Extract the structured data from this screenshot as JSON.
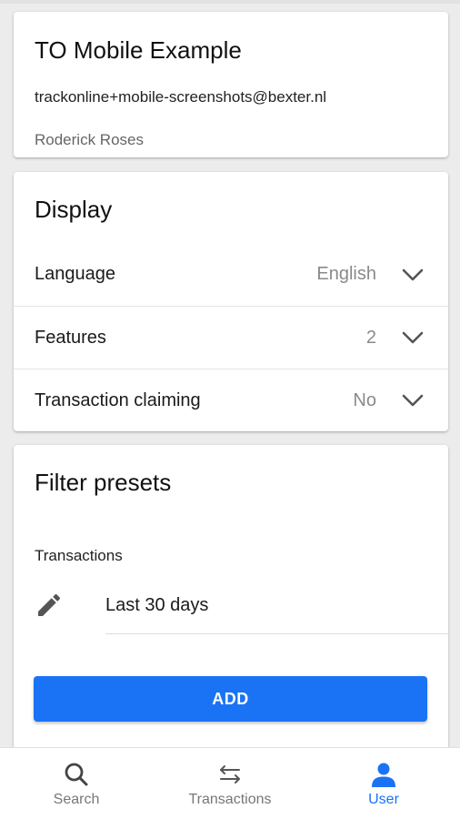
{
  "account": {
    "title": "TO Mobile Example",
    "email": "trackonline+mobile-screenshots@bexter.nl",
    "name": "Roderick Roses"
  },
  "display": {
    "title": "Display",
    "settings": [
      {
        "label": "Language",
        "value": "English"
      },
      {
        "label": "Features",
        "value": "2"
      },
      {
        "label": "Transaction claiming",
        "value": "No"
      }
    ]
  },
  "filter_presets": {
    "title": "Filter presets",
    "subtitle": "Transactions",
    "presets": [
      {
        "label": "Last 30 days",
        "icon": "pencil-icon"
      }
    ],
    "add_label": "ADD"
  },
  "bottom_nav": {
    "items": [
      {
        "label": "Search",
        "icon": "search-icon",
        "active": false
      },
      {
        "label": "Transactions",
        "icon": "swap-arrows-icon",
        "active": false
      },
      {
        "label": "User",
        "icon": "user-icon",
        "active": true
      }
    ]
  },
  "colors": {
    "accent": "#1a73f5",
    "background": "#ececec",
    "card": "#ffffff",
    "muted_text": "#8a8a8a"
  }
}
